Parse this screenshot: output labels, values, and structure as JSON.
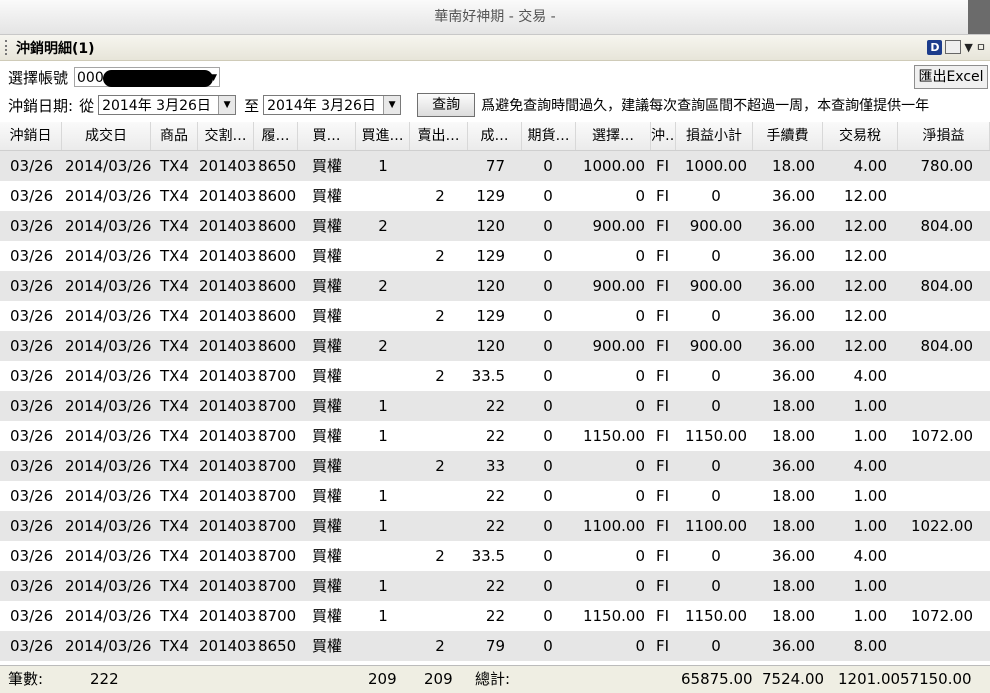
{
  "window": {
    "title": "華南好神期 - 交易 -"
  },
  "panel": {
    "title": "沖銷明細(1)",
    "icon_d": "D",
    "icon_pin": "ㅁ"
  },
  "account": {
    "label": "選擇帳號",
    "value": "000"
  },
  "export_label": "匯出Excel",
  "date_filter": {
    "label": "沖銷日期:",
    "from_label": "從",
    "from": "2014年 3月26日",
    "to_label": "至",
    "to": "2014年 3月26日"
  },
  "query_label": "查詢",
  "notice": "爲避免查詢時間過久，建議每次查詢區間不超過一周，本查詢僅提供一年",
  "columns": [
    "沖銷日",
    "成交日",
    "商品",
    "交割…",
    "履…",
    "買…",
    "買進…",
    "賣出…",
    "成…",
    "期貨…",
    "選擇…",
    "沖…",
    "損益小計",
    "手續費",
    "交易稅",
    "淨損益"
  ],
  "rows": [
    [
      "03/26",
      "2014/03/26",
      "TX4",
      "201403",
      "8650",
      "買權",
      "1",
      "",
      "77",
      "0",
      "1000.00",
      "FI",
      "1000.00",
      "18.00",
      "4.00",
      "780.00"
    ],
    [
      "03/26",
      "2014/03/26",
      "TX4",
      "201403",
      "8600",
      "買權",
      "",
      "2",
      "129",
      "0",
      "0",
      "FI",
      "0",
      "36.00",
      "12.00",
      ""
    ],
    [
      "03/26",
      "2014/03/26",
      "TX4",
      "201403",
      "8600",
      "買權",
      "2",
      "",
      "120",
      "0",
      "900.00",
      "FI",
      "900.00",
      "36.00",
      "12.00",
      "804.00"
    ],
    [
      "03/26",
      "2014/03/26",
      "TX4",
      "201403",
      "8600",
      "買權",
      "",
      "2",
      "129",
      "0",
      "0",
      "FI",
      "0",
      "36.00",
      "12.00",
      ""
    ],
    [
      "03/26",
      "2014/03/26",
      "TX4",
      "201403",
      "8600",
      "買權",
      "2",
      "",
      "120",
      "0",
      "900.00",
      "FI",
      "900.00",
      "36.00",
      "12.00",
      "804.00"
    ],
    [
      "03/26",
      "2014/03/26",
      "TX4",
      "201403",
      "8600",
      "買權",
      "",
      "2",
      "129",
      "0",
      "0",
      "FI",
      "0",
      "36.00",
      "12.00",
      ""
    ],
    [
      "03/26",
      "2014/03/26",
      "TX4",
      "201403",
      "8600",
      "買權",
      "2",
      "",
      "120",
      "0",
      "900.00",
      "FI",
      "900.00",
      "36.00",
      "12.00",
      "804.00"
    ],
    [
      "03/26",
      "2014/03/26",
      "TX4",
      "201403",
      "8700",
      "買權",
      "",
      "2",
      "33.5",
      "0",
      "0",
      "FI",
      "0",
      "36.00",
      "4.00",
      ""
    ],
    [
      "03/26",
      "2014/03/26",
      "TX4",
      "201403",
      "8700",
      "買權",
      "1",
      "",
      "22",
      "0",
      "0",
      "FI",
      "0",
      "18.00",
      "1.00",
      ""
    ],
    [
      "03/26",
      "2014/03/26",
      "TX4",
      "201403",
      "8700",
      "買權",
      "1",
      "",
      "22",
      "0",
      "1150.00",
      "FI",
      "1150.00",
      "18.00",
      "1.00",
      "1072.00"
    ],
    [
      "03/26",
      "2014/03/26",
      "TX4",
      "201403",
      "8700",
      "買權",
      "",
      "2",
      "33",
      "0",
      "0",
      "FI",
      "0",
      "36.00",
      "4.00",
      ""
    ],
    [
      "03/26",
      "2014/03/26",
      "TX4",
      "201403",
      "8700",
      "買權",
      "1",
      "",
      "22",
      "0",
      "0",
      "FI",
      "0",
      "18.00",
      "1.00",
      ""
    ],
    [
      "03/26",
      "2014/03/26",
      "TX4",
      "201403",
      "8700",
      "買權",
      "1",
      "",
      "22",
      "0",
      "1100.00",
      "FI",
      "1100.00",
      "18.00",
      "1.00",
      "1022.00"
    ],
    [
      "03/26",
      "2014/03/26",
      "TX4",
      "201403",
      "8700",
      "買權",
      "",
      "2",
      "33.5",
      "0",
      "0",
      "FI",
      "0",
      "36.00",
      "4.00",
      ""
    ],
    [
      "03/26",
      "2014/03/26",
      "TX4",
      "201403",
      "8700",
      "買權",
      "1",
      "",
      "22",
      "0",
      "0",
      "FI",
      "0",
      "18.00",
      "1.00",
      ""
    ],
    [
      "03/26",
      "2014/03/26",
      "TX4",
      "201403",
      "8700",
      "買權",
      "1",
      "",
      "22",
      "0",
      "1150.00",
      "FI",
      "1150.00",
      "18.00",
      "1.00",
      "1072.00"
    ],
    [
      "03/26",
      "2014/03/26",
      "TX4",
      "201403",
      "8650",
      "買權",
      "",
      "2",
      "79",
      "0",
      "0",
      "FI",
      "0",
      "36.00",
      "8.00",
      ""
    ]
  ],
  "footer": {
    "count_label": "筆數:",
    "count": "222",
    "buy_total": "209",
    "sell_total": "209",
    "total_label": "總計:",
    "pnl_total": "65875.00",
    "fee_total": "7524.00",
    "tax_total": "1201.00",
    "net_total": "57150.00"
  }
}
